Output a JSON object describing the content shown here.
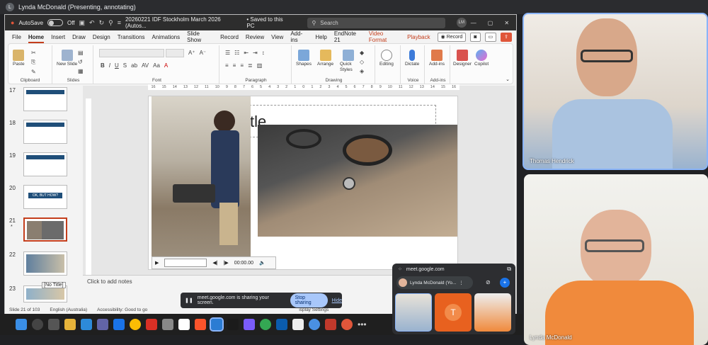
{
  "meet_header": {
    "presenter": "Lynda McDonald (Presenting, annotating)"
  },
  "ppt": {
    "autosave": "AutoSave",
    "toggle": "Off",
    "file_title": "20260221 IDF Stockholm March 2026 (Autos...",
    "save_state": "• Saved to this PC",
    "search": "Search",
    "user_initials": "LM",
    "tabs": [
      "File",
      "Home",
      "Insert",
      "Draw",
      "Design",
      "Transitions",
      "Animations",
      "Slide Show",
      "Record",
      "Review",
      "View",
      "Add-ins",
      "Help",
      "EndNote 21",
      "Video Format",
      "Playback"
    ],
    "record_btn": "Record",
    "ribbon": {
      "clipboard": {
        "label": "Clipboard",
        "paste": "Paste"
      },
      "slides": {
        "label": "Slides",
        "new_slide": "New Slide"
      },
      "font": {
        "label": "Font",
        "fmt": [
          "B",
          "I",
          "U",
          "S",
          "ab",
          "AV",
          "Aa"
        ]
      },
      "paragraph": {
        "label": "Paragraph"
      },
      "drawing": {
        "label": "Drawing",
        "shapes": "Shapes",
        "arrange": "Arrange",
        "quick": "Quick Styles"
      },
      "editing": {
        "label": "",
        "btn": "Editing"
      },
      "voice": {
        "label": "Voice",
        "btn": "Dictate"
      },
      "addins": {
        "label": "Add-ins",
        "btn": "Add-ins"
      },
      "designer": "Designer",
      "copilot": "Copilot"
    },
    "thumbs": [
      {
        "n": "17"
      },
      {
        "n": "18"
      },
      {
        "n": "19"
      },
      {
        "n": "20",
        "text": "OK, BUT HOW?"
      },
      {
        "n": "21",
        "star": "*"
      },
      {
        "n": "22"
      },
      {
        "n": "23"
      }
    ],
    "tooltip": "[No Title]",
    "ruler_ticks": [
      "16",
      "15",
      "14",
      "13",
      "12",
      "11",
      "10",
      "9",
      "8",
      "7",
      "6",
      "5",
      "4",
      "3",
      "2",
      "1",
      "0",
      "1",
      "2",
      "3",
      "4",
      "5",
      "6",
      "7",
      "8",
      "9",
      "10",
      "11",
      "12",
      "13",
      "14",
      "15",
      "16"
    ],
    "slide_title_frag": "tle",
    "video_time": "00:00.00",
    "notes": "Click to add notes",
    "status": {
      "slide": "Slide 21 of 103",
      "lang": "English (Australia)",
      "access": "Accessibility: Good to go",
      "display": "isplay Settings"
    }
  },
  "share_banner": {
    "text": "meet.google.com is sharing your screen.",
    "stop": "Stop sharing",
    "hide": "Hide"
  },
  "participants": [
    {
      "name": "Thomas Hendrick"
    },
    {
      "name": "Lynda McDonald"
    }
  ],
  "mini": {
    "url": "meet.google.com",
    "self": "Lynda McDonald (Yo...",
    "tile_letter": "T"
  },
  "colors": {
    "accent": "#c43e1c",
    "meet_blue": "#a8c7fa"
  }
}
